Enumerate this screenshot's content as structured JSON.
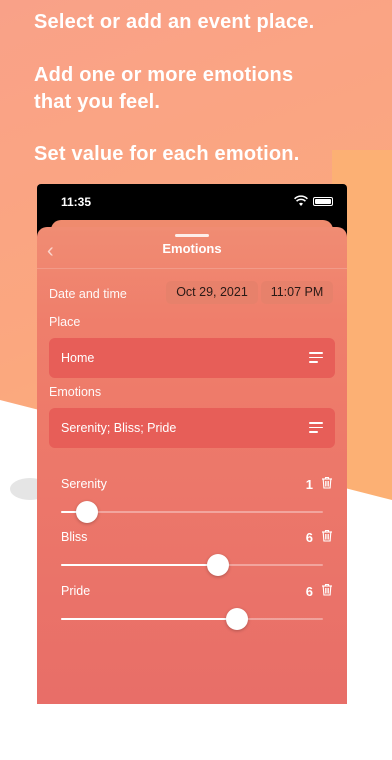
{
  "promo": {
    "line1": "Select or add an event place.",
    "line2a": "Add one or more emotions",
    "line2b": "that you feel.",
    "line3": "Set value for each emotion."
  },
  "status_bar": {
    "time": "11:35"
  },
  "nav": {
    "back_icon": "chevron-left-icon",
    "title": "Emotions"
  },
  "form": {
    "date_time_label": "Date and time",
    "date_value": "Oct 29, 2021",
    "time_value": "11:07 PM",
    "place_label": "Place",
    "place_value": "Home",
    "emotions_label": "Emotions",
    "emotions_value": "Serenity; Bliss; Pride"
  },
  "emotions": [
    {
      "name": "Serenity",
      "value": "1",
      "level": 0.1
    },
    {
      "name": "Bliss",
      "value": "6",
      "level": 0.6
    },
    {
      "name": "Pride",
      "value": "6",
      "level": 0.67
    }
  ],
  "colors": {
    "accent": "#e75e58",
    "sheet": "#ef7e6b",
    "background": "#fba77f"
  }
}
